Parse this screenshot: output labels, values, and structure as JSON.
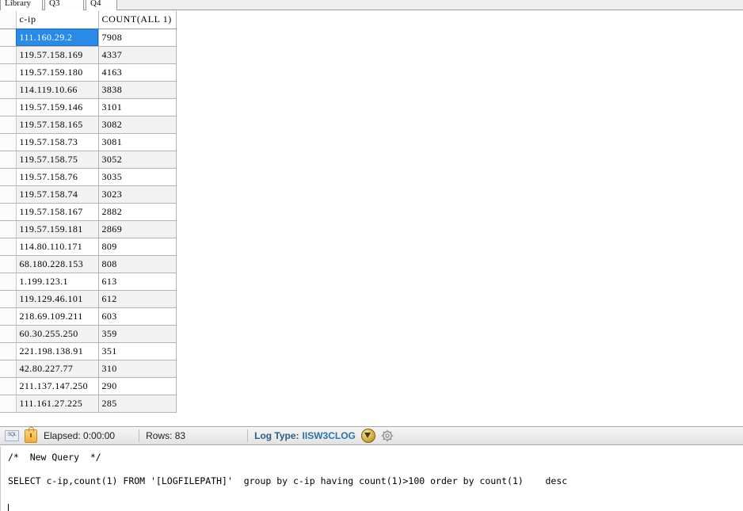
{
  "tabs": [
    {
      "label": "Library",
      "active": false
    },
    {
      "label": "Q3",
      "active": false
    },
    {
      "label": "Q4",
      "active": true
    }
  ],
  "grid": {
    "columns": [
      "c-ip",
      "COUNT(ALL 1)"
    ],
    "selected_row": 0,
    "rows": [
      [
        "111.160.29.2",
        "7908"
      ],
      [
        "119.57.158.169",
        "4337"
      ],
      [
        "119.57.159.180",
        "4163"
      ],
      [
        "114.119.10.66",
        "3838"
      ],
      [
        "119.57.159.146",
        "3101"
      ],
      [
        "119.57.158.165",
        "3082"
      ],
      [
        "119.57.158.73",
        "3081"
      ],
      [
        "119.57.158.75",
        "3052"
      ],
      [
        "119.57.158.76",
        "3035"
      ],
      [
        "119.57.158.74",
        "3023"
      ],
      [
        "119.57.158.167",
        "2882"
      ],
      [
        "119.57.159.181",
        "2869"
      ],
      [
        "114.80.110.171",
        "809"
      ],
      [
        "68.180.228.153",
        "808"
      ],
      [
        "1.199.123.1",
        "613"
      ],
      [
        "119.129.46.101",
        "612"
      ],
      [
        "218.69.109.211",
        "603"
      ],
      [
        "60.30.255.250",
        "359"
      ],
      [
        "221.198.138.91",
        "351"
      ],
      [
        "42.80.227.77",
        "310"
      ],
      [
        "211.137.147.250",
        "290"
      ],
      [
        "111.161.27.225",
        "285"
      ]
    ]
  },
  "statusbar": {
    "sql_badge": "SQL",
    "elapsed": "Elapsed: 0:00:00",
    "rows": "Rows: 83",
    "log_type_label": "Log Type:",
    "log_type_value": "IISW3CLOG"
  },
  "editor": {
    "comment_line": "/*  New Query  */",
    "query_line": "SELECT c-ip,count(1) FROM '[LOGFILEPATH]'  group by c-ip having count(1)>100 order by count(1)    desc"
  },
  "colors": {
    "selection_blue": "#2a8ae8",
    "stripe_gray": "#f2f2f2",
    "log_type_blue": "#2b5d84",
    "lock_orange": "#f0ae35"
  }
}
